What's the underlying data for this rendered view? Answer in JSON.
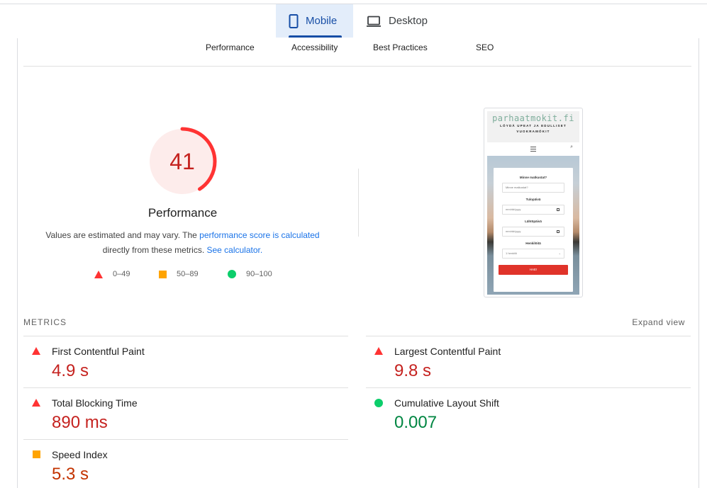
{
  "device_tabs": [
    {
      "label": "Mobile",
      "icon": "mobile-phone-icon",
      "active": true
    },
    {
      "label": "Desktop",
      "icon": "laptop-icon",
      "active": false
    }
  ],
  "category_tabs": [
    "Performance",
    "Accessibility",
    "Best Practices",
    "SEO"
  ],
  "score": {
    "value": 41,
    "fraction": 0.41,
    "title": "Performance",
    "color_fail": "#ff3333",
    "color_fail_bg": "#fdeceb",
    "color_text": "#c5221f"
  },
  "description": {
    "text1": "Values are estimated and may vary. The ",
    "link1": "performance score is calculated",
    "text2": "directly from these metrics. ",
    "link2": "See calculator."
  },
  "legend": [
    {
      "shape": "triangle",
      "range": "0–49",
      "color": "#ff3333"
    },
    {
      "shape": "square",
      "range": "50–89",
      "color": "#ffa400"
    },
    {
      "shape": "circle",
      "range": "90–100",
      "color": "#0cce6b"
    }
  ],
  "screenshot": {
    "site_logo": "parhaatmokit.fi",
    "tagline_line1": "LÖYDÄ UPEAT JA EDULLISET",
    "tagline_line2": "VUOKRAMÖKIT",
    "q_where": "Minne matkustat?",
    "q_where_placeholder": "Minne matkustat?",
    "q_arrival": "Tulopäivä",
    "date_placeholder": "mm/dd/yyyy",
    "q_departure": "Lähtöpäivä",
    "q_persons": "Henkilöitä",
    "persons_value": "1 henkilö",
    "submit": "HAE!"
  },
  "metrics": {
    "heading": "METRICS",
    "expand_label": "Expand view",
    "left": [
      {
        "name": "First Contentful Paint",
        "value": "4.9 s",
        "rating": "fail"
      },
      {
        "name": "Total Blocking Time",
        "value": "890 ms",
        "rating": "fail"
      },
      {
        "name": "Speed Index",
        "value": "5.3 s",
        "rating": "average"
      }
    ],
    "right": [
      {
        "name": "Largest Contentful Paint",
        "value": "9.8 s",
        "rating": "fail"
      },
      {
        "name": "Cumulative Layout Shift",
        "value": "0.007",
        "rating": "pass"
      }
    ]
  }
}
